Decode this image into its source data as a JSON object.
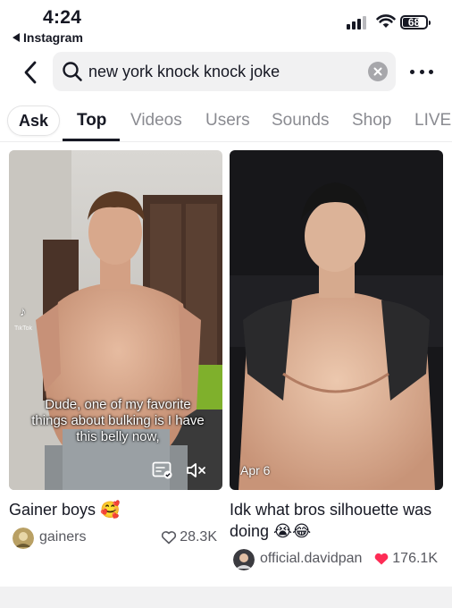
{
  "status_bar": {
    "time": "4:24",
    "back_app": "Instagram",
    "battery": "68"
  },
  "search": {
    "query": "new york knock knock joke"
  },
  "tabs": [
    {
      "label": "Ask"
    },
    {
      "label": "Top"
    },
    {
      "label": "Videos"
    },
    {
      "label": "Users"
    },
    {
      "label": "Sounds"
    },
    {
      "label": "Shop"
    },
    {
      "label": "LIVE"
    }
  ],
  "active_tab": "Top",
  "results": [
    {
      "overlay_caption": "Dude, one of my favorite things about bulking is I have this belly now,",
      "overlay_brand": "TikTok",
      "title": "Gainer boys 🥰",
      "author": "gainers",
      "likes": "28.3K",
      "liked": false
    },
    {
      "date": "Apr 6",
      "title": "Idk what bros silhouette was doing 😭😂",
      "author": "official.davidpan",
      "likes": "176.1K",
      "liked": true
    }
  ],
  "colors": {
    "accent_heart": "#fe2c55",
    "text_primary": "#161823",
    "text_secondary": "#8a8b91"
  }
}
